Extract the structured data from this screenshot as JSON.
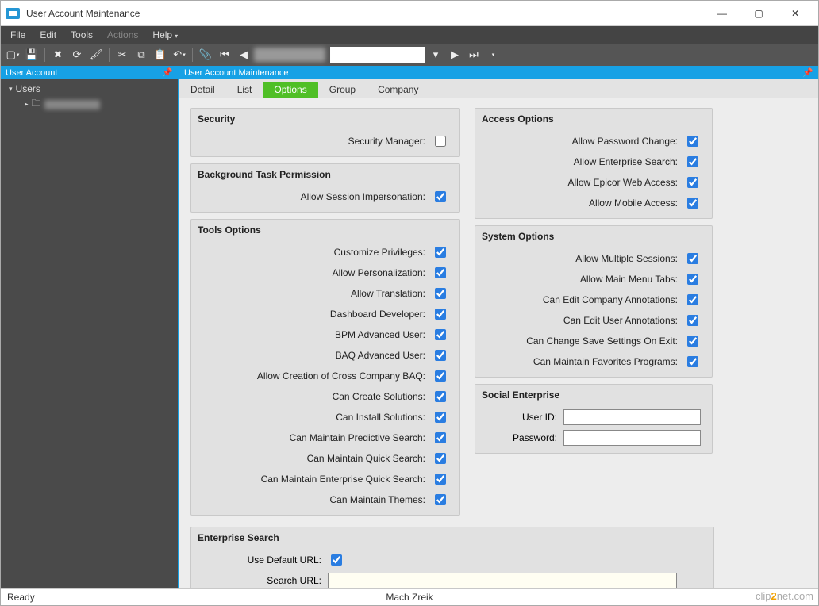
{
  "window": {
    "title": "User Account Maintenance"
  },
  "winbtns": {
    "min": "—",
    "max": "▢",
    "close": "✕"
  },
  "menu": {
    "file": "File",
    "edit": "Edit",
    "tools": "Tools",
    "actions": "Actions",
    "help": "Help"
  },
  "sidepanel": {
    "title": "User Account",
    "root": "Users"
  },
  "contentpanel": {
    "title": "User Account Maintenance"
  },
  "tabs": {
    "detail": "Detail",
    "list": "List",
    "options": "Options",
    "group": "Group",
    "company": "Company"
  },
  "sections": {
    "security": {
      "title": "Security",
      "manager": "Security Manager:"
    },
    "bgtask": {
      "title": "Background Task Permission",
      "impersonation": "Allow Session Impersonation:"
    },
    "tools": {
      "title": "Tools Options",
      "custpriv": "Customize Privileges:",
      "personalization": "Allow Personalization:",
      "translation": "Allow Translation:",
      "dashdev": "Dashboard Developer:",
      "bpm": "BPM Advanced User:",
      "baq": "BAQ Advanced User:",
      "crossbaq": "Allow Creation of Cross Company BAQ:",
      "createsol": "Can Create Solutions:",
      "installsol": "Can Install Solutions:",
      "predsearch": "Can Maintain Predictive Search:",
      "quicksearch": "Can Maintain Quick Search:",
      "entquicksearch": "Can Maintain Enterprise Quick Search:",
      "themes": "Can Maintain Themes:"
    },
    "access": {
      "title": "Access Options",
      "pwdchange": "Allow Password Change:",
      "entsearch": "Allow Enterprise Search:",
      "webaccess": "Allow Epicor Web Access:",
      "mobile": "Allow Mobile Access:"
    },
    "system": {
      "title": "System Options",
      "multises": "Allow Multiple Sessions:",
      "menutabs": "Allow Main Menu Tabs:",
      "compannot": "Can Edit Company Annotations:",
      "userannot": "Can Edit User Annotations:",
      "savesettings": "Can Change Save Settings On Exit:",
      "favorites": "Can Maintain Favorites Programs:"
    },
    "social": {
      "title": "Social Enterprise",
      "userid": "User ID:",
      "password": "Password:"
    },
    "entsearch": {
      "title": "Enterprise Search",
      "defaulturl": "Use Default URL:",
      "searchurl": "Search URL:"
    }
  },
  "values": {
    "security_manager": false,
    "impersonation": true,
    "custpriv": true,
    "personalization": true,
    "translation": true,
    "dashdev": true,
    "bpm": true,
    "baq": true,
    "crossbaq": true,
    "createsol": true,
    "installsol": true,
    "predsearch": true,
    "quicksearch": true,
    "entquicksearch": true,
    "themes": true,
    "pwdchange": true,
    "entsearch": true,
    "webaccess": true,
    "mobile": true,
    "multises": true,
    "menutabs": true,
    "compannot": true,
    "userannot": true,
    "savesettings": true,
    "favorites": true,
    "defaulturl": true,
    "searchurl": "",
    "social_userid": "",
    "social_password": ""
  },
  "status": {
    "left": "Ready",
    "center": "Mach Zreik"
  },
  "watermark": {
    "pre": "clip",
    "mid": "2",
    "post": "net",
    "suffix": ".com"
  }
}
